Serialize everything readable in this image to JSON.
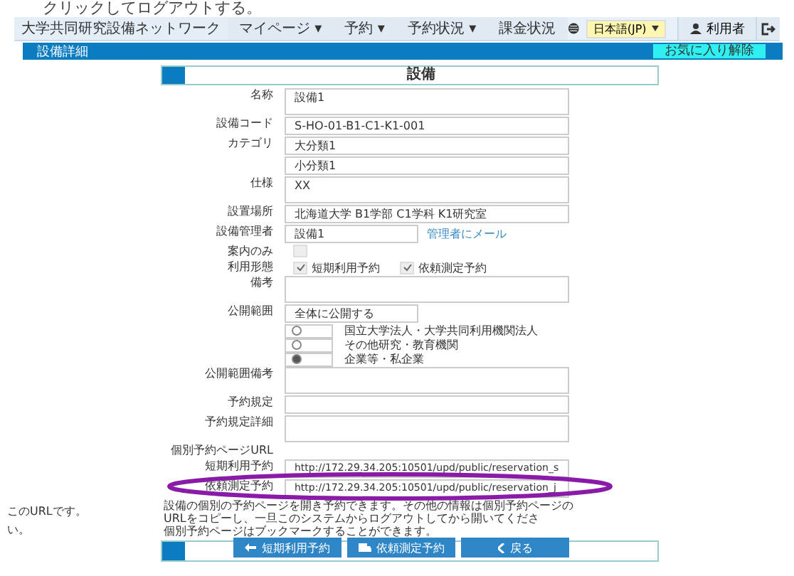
{
  "caption": "クリックしてログアウトする。",
  "nav": {
    "brand": "大学共同研究設備ネットワーク",
    "menus": [
      {
        "label": "マイページ ▾"
      },
      {
        "label": "予約 ▾"
      },
      {
        "label": "予約状況 ▾"
      },
      {
        "label": "課金状況"
      }
    ],
    "language": "日本語(JP)",
    "user": "利用者"
  },
  "section_bar": {
    "title": "設備詳細",
    "button": "お気に入り解除"
  },
  "card_title": "設備",
  "fields": [
    {
      "kind": "textarea",
      "label": "名称",
      "value": "設備1"
    },
    {
      "kind": "text",
      "label": "設備コード",
      "values": [
        "S-HO-01-B1-C1-K1-001"
      ]
    },
    {
      "kind": "text",
      "label": "カテゴリ",
      "values": [
        "大分類1",
        "小分類1"
      ]
    },
    {
      "kind": "textarea",
      "label": "仕様",
      "value": "XX"
    },
    {
      "kind": "text",
      "label": "設置場所",
      "values": [
        "北海道大学 B1学部 C1学科 K1研究室"
      ]
    },
    {
      "kind": "text_link",
      "label": "設備管理者",
      "value": "設備1",
      "link": "管理者にメール"
    },
    {
      "kind": "checkbox",
      "label": "案内のみ",
      "checked": false
    },
    {
      "kind": "checks",
      "label": "利用形態",
      "options": [
        {
          "label": "短期利用予約",
          "checked": true
        },
        {
          "label": "依頼測定予約",
          "checked": true
        }
      ]
    },
    {
      "kind": "textarea",
      "label": "備考"
    },
    {
      "kind": "radios",
      "label": "公開範囲",
      "value": "全体に公開する",
      "options": [
        {
          "label": "国立大学法人・大学共同利用機関法人",
          "selected": false
        },
        {
          "label": "その他研究・教育機関",
          "selected": false
        },
        {
          "label": "企業等・私企業",
          "selected": true
        }
      ]
    },
    {
      "kind": "textarea",
      "label": "公開範囲備考"
    },
    {
      "kind": "text",
      "label": "予約規定"
    },
    {
      "kind": "textarea",
      "label": "予約規定詳細"
    },
    {
      "kind": "label",
      "label": "個別予約ページURL"
    },
    {
      "kind": "url",
      "label": "短期利用予約",
      "value": "http://172.29.34.205:10501/upd/public/reservation_s",
      "highlighted": false
    },
    {
      "kind": "url",
      "label": "依頼測定予約",
      "value": "http://172.29.34.205:10501/upd/public/reservation_j",
      "highlighted": true
    }
  ],
  "note": {
    "side": [
      "このURLです。",
      "い。"
    ],
    "lines": [
      "設備の個別の予約ページを開き予約できます。その他の情報は個別予約ページの",
      "URLをコピーし、一旦このシステムからログアウトしてから開いてくださ",
      "個別予約ページはブックマークすることができます。"
    ]
  },
  "buttons": [
    {
      "label": "短期利用予約"
    },
    {
      "label": "依頼測定予約"
    },
    {
      "label": "戻る"
    }
  ]
}
